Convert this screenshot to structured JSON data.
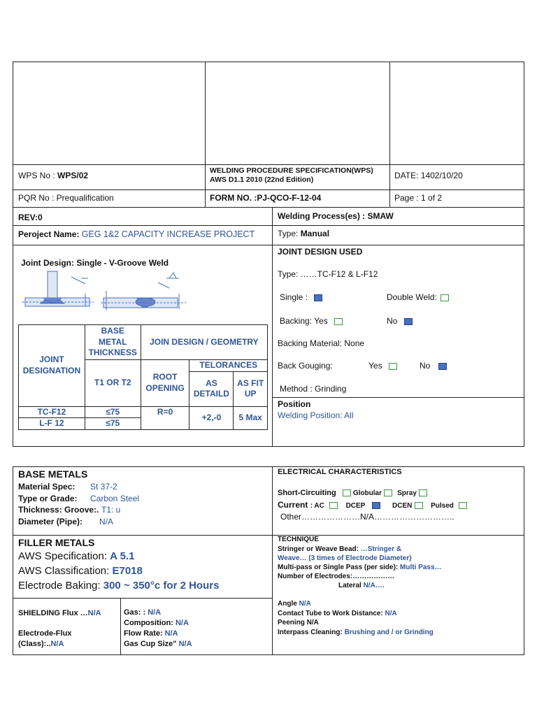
{
  "header": {
    "wps_no_label": "WPS No :",
    "wps_no_value": "WPS/02",
    "title_line1": "WELDING PROCEDURE SPECIFICATION(WPS)",
    "title_line2": "AWS D1.1 2010 (22nd Edition)",
    "date": "DATE: 1402/10/20",
    "pqr": "PQR No : Prequalification",
    "form_no": "FORM NO.  :PJ-QCO-F-12-04",
    "page": "Page : 1 of 2"
  },
  "info": {
    "rev": "REV:0",
    "process_label": "Welding Process(es) : ",
    "process_value": "SMAW",
    "project_label": "Peroject Name: ",
    "project_value": "GEG 1&2 CAPACITY INCREASE PROJECT",
    "type_label": "Type: ",
    "type_value": "Manual"
  },
  "joint_design": {
    "left_title": "Joint Design: Single - V-Groove Weld",
    "used_title": "JOINT DESIGN USED",
    "type_line": "Type: ……TC-F12 & L-F12",
    "single_label": "Single :",
    "double_label": "Double Weld:",
    "backing_label": "Backing: Yes",
    "backing_no": "No",
    "backing_material": "Backing Material: None",
    "back_gouging": "Back Gouging:",
    "yes": "Yes",
    "no": "No",
    "method": "Method :    Grinding",
    "position_title": "Position",
    "welding_position": "Welding Position:   All"
  },
  "joint_table": {
    "joint_designation": "JOINT DESIGNATION",
    "base_metal_thickness": "BASE METAL THICKNESS",
    "join_design": "JOIN DESIGN / GEOMETRY",
    "t1_t2": "T1 OR T2",
    "root_opening": "ROOT OPENING",
    "tolerances": "TELORANCES",
    "as_detaild": "AS DETAILD",
    "as_fit_up": "AS FIT UP",
    "rows": [
      {
        "joint": "TC-F12",
        "thickness": "≤75"
      },
      {
        "joint": "L-F 12",
        "thickness": "≤75"
      }
    ],
    "root_value": "R=0",
    "detaild_value": "+2,-0",
    "fitup_value": "5 Max"
  },
  "base_metals": {
    "title": "BASE METALS",
    "material_spec_label": "Material Spec:",
    "material_spec_value": "St 37-2",
    "grade_label": "Type or Grade:",
    "grade_value": "Carbon Steel",
    "thickness_label": "Thickness: Groove:.",
    "thickness_value": "T1: u",
    "diameter_label": "Diameter (Pipe):",
    "diameter_value": "N/A"
  },
  "filler_metals": {
    "title": "FILLER METALS",
    "aws_spec_label": "AWS Specification: ",
    "aws_spec_value": "A 5.1",
    "aws_class_label": "AWS Classification: ",
    "aws_class_value": "E7018",
    "baking_label": "Electrode Baking: ",
    "baking_value": "300 ~ 350°c for 2 Hours"
  },
  "shielding": {
    "flux_label": "SHIELDING Flux …",
    "flux_value": "N/A",
    "electrode_flux_label": "Electrode-Flux",
    "class_label": "(Class):..",
    "class_value": "N/A",
    "gas_label": "Gas: : ",
    "gas_value": "N/A",
    "composition_label": "Composition: ",
    "composition_value": "N/A",
    "flow_label": "Flow Rate: ",
    "flow_value": "N/A",
    "cup_label": "Gas Cup Size\" ",
    "cup_value": "N/A"
  },
  "electrical": {
    "title": "ELECTRICAL CHARACTERISTICS",
    "short_circuiting": "Short-Circuiting",
    "globular": "Globular",
    "spray": "Spray",
    "current": "Current",
    "ac": ": AC",
    "dcep": "DCEP",
    "dcen": "DCEN",
    "pulsed": "Pulsed",
    "other": "Other…………………N/A……………………….."
  },
  "technique": {
    "title": "TECHNIQUE",
    "stringer_label": "Stringer or Weave Bead: ",
    "stringer_value_1": "…Stringer &",
    "stringer_value_2": "Weave… (3 times of Electrode Diameter)",
    "multipass_label": "Multi-pass or Single Pass (per side): ",
    "multipass_value": "Multi Pass…",
    "num_electrodes": "Number of Electrodes:………………",
    "lateral_label": "Lateral ",
    "lateral_value": "N/A….",
    "angle_label": "Angle ",
    "angle_value": "N/A",
    "contact_label": "Contact Tube to Work Distance: ",
    "contact_value": "N/A",
    "peening": "Peening N/A",
    "interpass_label": "Interpass Cleaning: ",
    "interpass_value": "Brushing and / or Grinding"
  }
}
